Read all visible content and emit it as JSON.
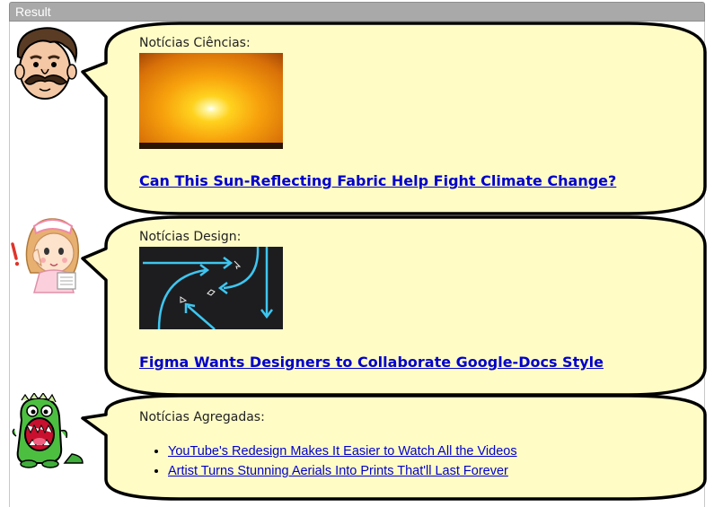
{
  "window": {
    "title": "Result"
  },
  "posts": [
    {
      "heading": "Notícias Ciências:",
      "link": "Can This Sun-Reflecting Fabric Help Fight Climate Change?"
    },
    {
      "heading": "Notícias Design:",
      "link": "Figma Wants Designers to Collaborate Google-Docs Style"
    },
    {
      "heading": "Notícias Agregadas:",
      "items": [
        "YouTube's Redesign Makes It Easier to Watch All the Videos",
        "Artist Turns Stunning Aerials Into Prints That'll Last Forever"
      ]
    }
  ],
  "colors": {
    "bubble": "#fffcc6",
    "link": "#0000cc",
    "titlebar": "#a9a9a9"
  }
}
